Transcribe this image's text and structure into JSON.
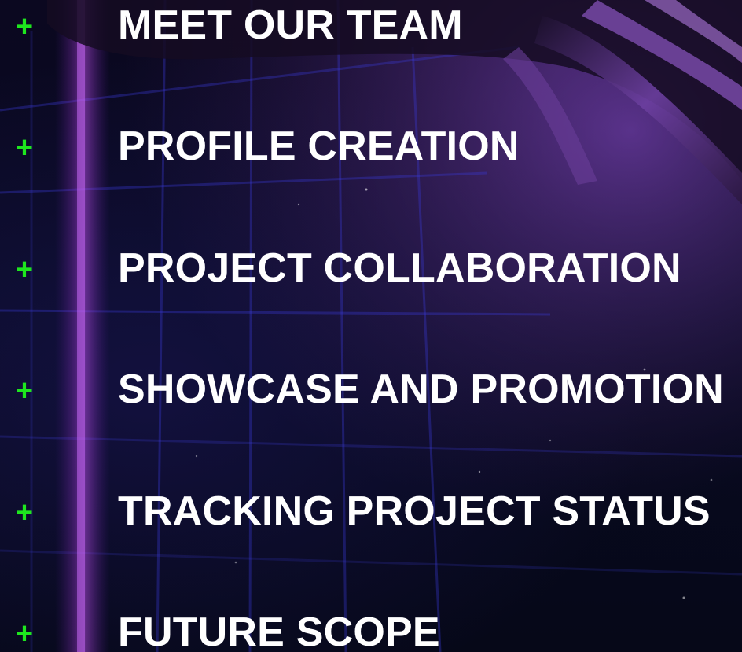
{
  "menu": {
    "items": [
      {
        "marker": "+",
        "label": "MEET OUR TEAM"
      },
      {
        "marker": "+",
        "label": "PROFILE CREATION"
      },
      {
        "marker": "+",
        "label": "PROJECT COLLABORATION"
      },
      {
        "marker": "+",
        "label": "SHOWCASE AND PROMOTION"
      },
      {
        "marker": "+",
        "label": "TRACKING PROJECT STATUS"
      },
      {
        "marker": "+",
        "label": "FUTURE SCOPE"
      }
    ]
  },
  "colors": {
    "marker": "#1ee61e",
    "label": "#ffffff",
    "background": "#05051a",
    "grid_lines": "#3a3ad8",
    "neon_beam": "#9a2fd0",
    "drape": "#8a55c0"
  }
}
